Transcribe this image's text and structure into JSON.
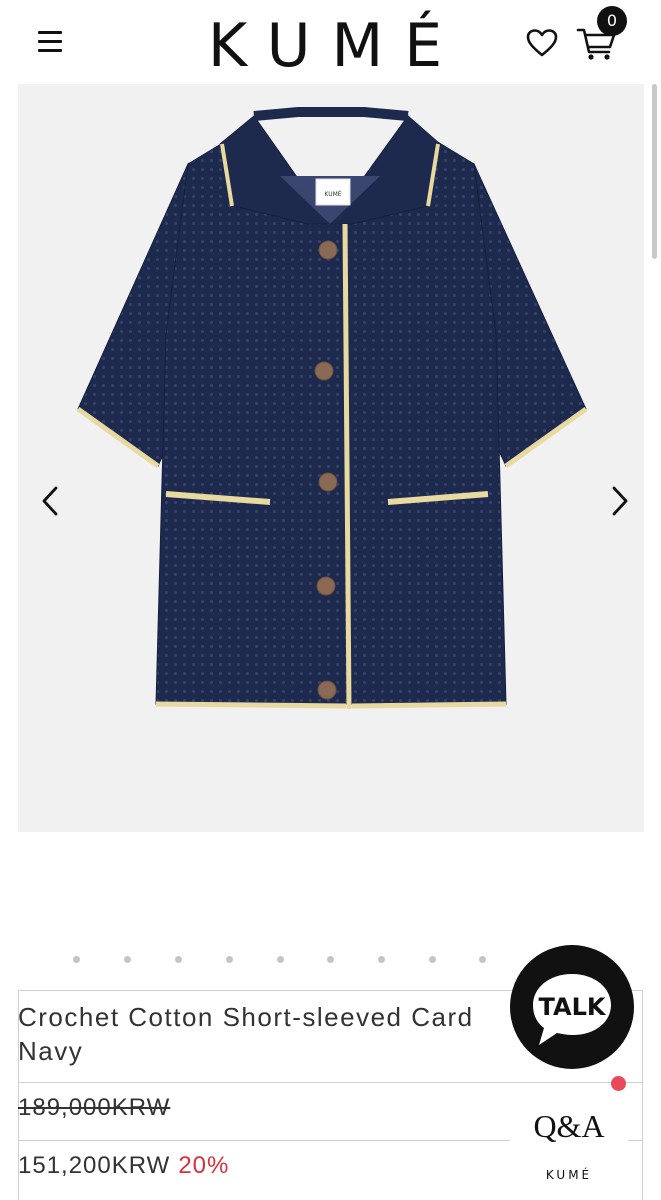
{
  "header": {
    "logo": "KUMÉ",
    "cart_count": "0",
    "icons": {
      "menu": "hamburger-menu-icon",
      "wishlist": "heart-icon",
      "cart": "cart-icon"
    }
  },
  "product": {
    "name_line1": "Crochet Cotton Short-sleeved Card",
    "name_line2": "Navy",
    "original_price": "189,000KRW",
    "sale_price": "151,200KRW",
    "discount": "20%"
  },
  "image": {
    "label_text": "KUMÉ",
    "colors": {
      "garment": "#1d2a4e",
      "trim": "#e8d9a0",
      "button": "#8a6a55",
      "background": "#f1f1f1"
    }
  },
  "gallery": {
    "slide_count": 9
  },
  "floating": {
    "talk_label": "TALK",
    "qa_label": "Q&A",
    "qa_brand": "KUMÉ"
  },
  "colors": {
    "discount": "#d9303a",
    "notice": "#e84a5a",
    "text": "#333333"
  }
}
